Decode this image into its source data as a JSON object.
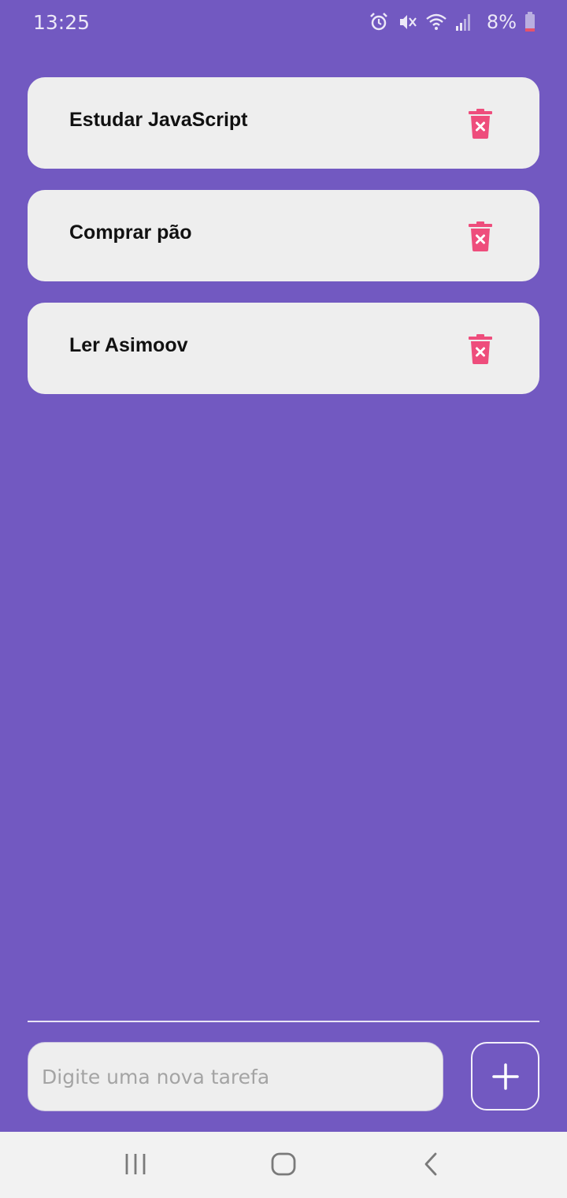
{
  "status_bar": {
    "time": "13:25",
    "battery_text": "8%",
    "icons": [
      "alarm-icon",
      "vibrate-mute-icon",
      "wifi-icon",
      "signal-icon",
      "battery-icon"
    ]
  },
  "tasks": [
    {
      "text": "Estudar JavaScript",
      "delete_icon": "trash-delete-icon"
    },
    {
      "text": "Comprar pão",
      "delete_icon": "trash-delete-icon"
    },
    {
      "text": "Ler Asimoov",
      "delete_icon": "trash-delete-icon"
    }
  ],
  "input": {
    "placeholder": "Digite uma nova tarefa",
    "value": ""
  },
  "add_button": {
    "icon": "plus-icon"
  },
  "nav_bar": {
    "icons": [
      "recent-apps-icon",
      "home-icon",
      "back-icon"
    ]
  },
  "colors": {
    "background": "#7259c1",
    "card": "#eeeeee",
    "delete_accent": "#ee4d7c",
    "text": "#111111",
    "placeholder": "#a4a4a4"
  }
}
